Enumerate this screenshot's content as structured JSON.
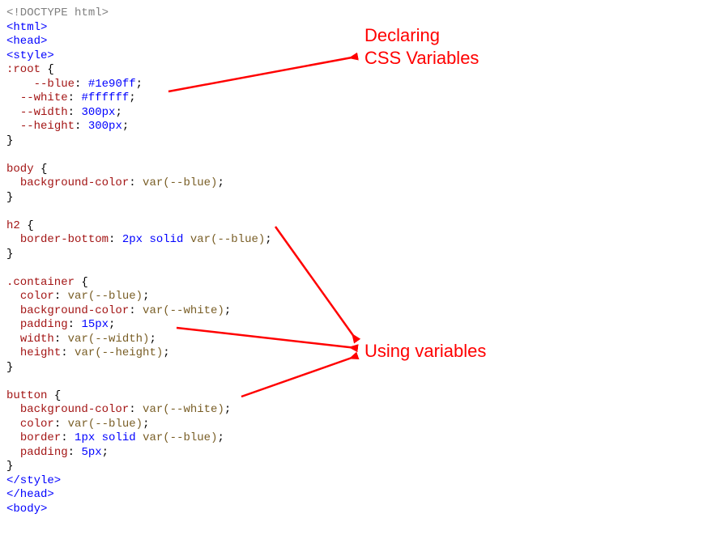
{
  "annotations": {
    "declaring_line1": "Declaring",
    "declaring_line2": "CSS Variables",
    "using_line1": "Using variables"
  },
  "code": {
    "doctype": "<!DOCTYPE html>",
    "tag_html_open": "<html>",
    "tag_head_open": "<head>",
    "tag_style_open": "<style>",
    "sel_root": ":root",
    "brace_open": " {",
    "decl_blue_prop": "--blue",
    "decl_blue_val": "#1e90ff",
    "decl_white_prop": "--white",
    "decl_white_val": "#ffffff",
    "decl_width_prop": "--width",
    "decl_width_val": "300px",
    "decl_height_prop": "--height",
    "decl_height_val": "300px",
    "brace_close": "}",
    "sel_body": "body",
    "prop_bgcolor": "background-color",
    "val_var_blue": "var(--blue)",
    "sel_h2": "h2",
    "prop_border_bottom": "border-bottom",
    "val_2px_solid": "2px solid ",
    "sel_container": ".container",
    "prop_color": "color",
    "val_var_white": "var(--white)",
    "prop_padding": "padding",
    "val_15px": "15px",
    "prop_width": "width",
    "val_var_width": "var(--width)",
    "prop_height": "height",
    "val_var_height": "var(--height)",
    "sel_button": "button",
    "prop_border": "border",
    "val_1px_solid": "1px solid ",
    "val_5px": "5px",
    "tag_style_close": "</style>",
    "tag_head_close": "</head>",
    "tag_body_open": "<body>",
    "indent2": "  ",
    "indent4": "    ",
    "colon_sp": ": ",
    "semi": ";"
  }
}
